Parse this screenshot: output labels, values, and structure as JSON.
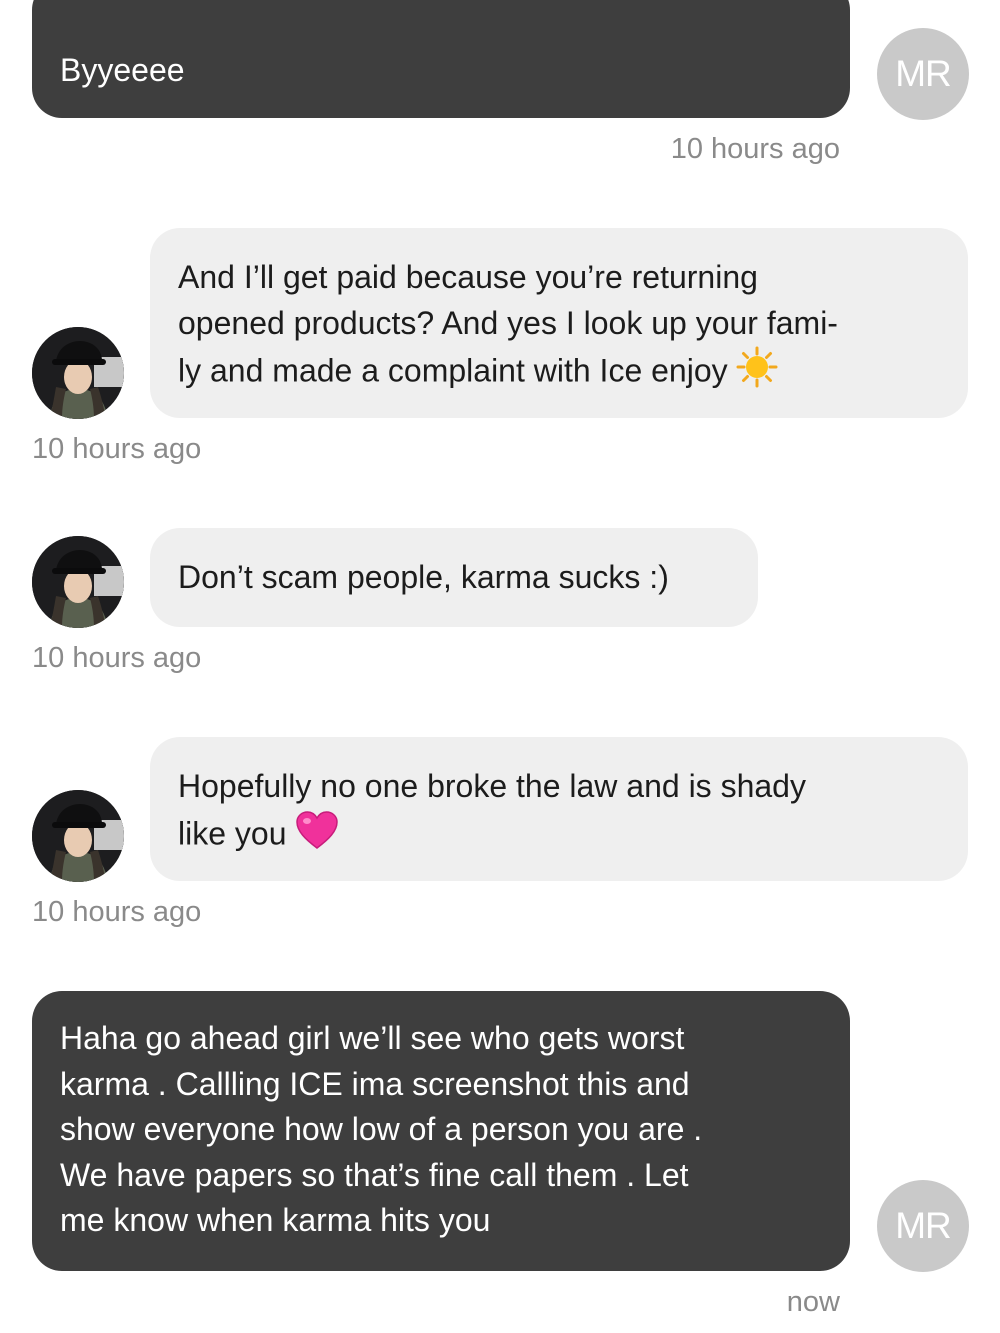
{
  "messages": [
    {
      "text": "Byyeeee",
      "time": "10 hours ago",
      "avatar": "MR"
    },
    {
      "text": "And I’ll get paid because you’re returning opened products? And yes I look up your fami-ly and made a complaint with Ice enjoy",
      "line1": "And I’ll get paid because you’re returning",
      "line2": "opened products? And yes I look up your fami-",
      "line3": "ly and made a complaint with Ice enjoy",
      "emoji": "sun-emoji",
      "time": "10 hours ago"
    },
    {
      "text": "Don’t scam people, karma sucks :)",
      "time": "10 hours ago"
    },
    {
      "line1": "Hopefully no one broke the law and is shady",
      "line2": "like you",
      "emoji": "pink-heart-emoji",
      "time": "10 hours ago"
    },
    {
      "line1": "Haha go ahead girl we’ll see who gets worst",
      "line2": "karma . Callling ICE ima screenshot this and",
      "line3": "show everyone how low of a person you are .",
      "line4": "We have papers so that’s fine call them . Let",
      "line5": "me know when karma hits you",
      "time": "now",
      "avatar": "MR"
    }
  ],
  "colors": {
    "outgoing_bubble": "#3e3e3e",
    "incoming_bubble": "#efefef",
    "avatar_initials_bg": "#c9c9c9",
    "timestamp": "#8a8a8a"
  }
}
